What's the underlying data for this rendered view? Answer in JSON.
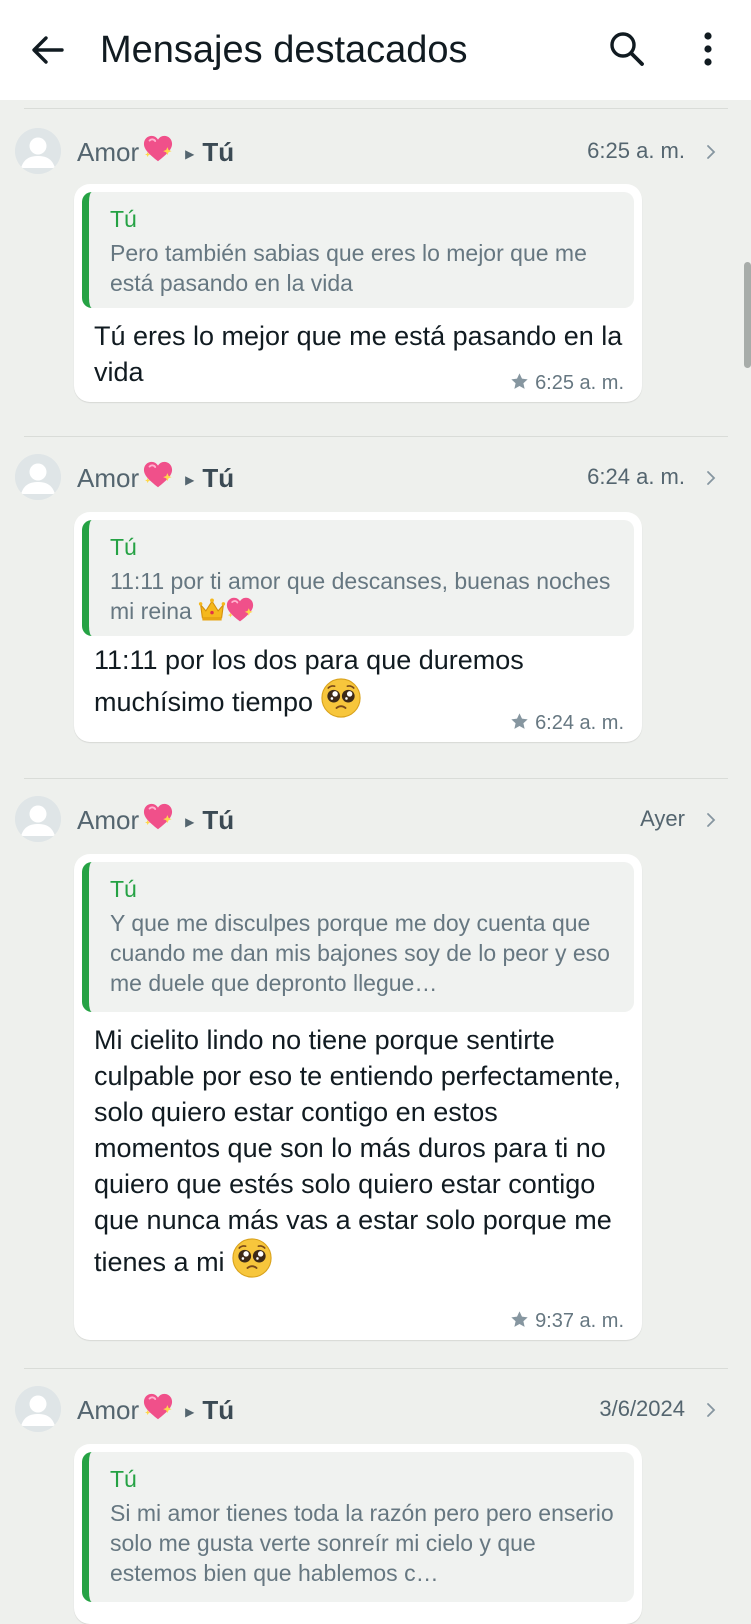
{
  "header": {
    "title": "Mensajes destacados",
    "icons": {
      "back": "arrow-left-icon",
      "search": "search-icon",
      "more": "more-vertical-icon"
    }
  },
  "colors": {
    "accent_green": "#25a244",
    "background": "#eef0ed",
    "bubble": "#ffffff",
    "quote_bg": "#f0f2f0",
    "secondary_text": "#667781"
  },
  "messages": [
    {
      "sender": "Amor",
      "sender_icon": "sparkling-heart-icon",
      "recipient": "Tú",
      "date": "6:25 a. m.",
      "quote_author": "Tú",
      "quote_text": "Pero también sabias que eres lo mejor que me está pasando en la vida",
      "text": "Tú eres lo mejor que me está pasando en la vida",
      "time": "6:25 a. m."
    },
    {
      "sender": "Amor",
      "sender_icon": "sparkling-heart-icon",
      "recipient": "Tú",
      "date": "6:24 a. m.",
      "quote_author": "Tú",
      "quote_text": "11:11 por ti amor que descanses, buenas noches mi reina",
      "quote_emojis": [
        "crown-icon",
        "sparkling-heart-icon"
      ],
      "text": "11:11 por los dos para que duremos muchísimo tiempo",
      "text_emoji": "pleading-face-icon",
      "time": "6:24 a. m."
    },
    {
      "sender": "Amor",
      "sender_icon": "sparkling-heart-icon",
      "recipient": "Tú",
      "date": "Ayer",
      "quote_author": "Tú",
      "quote_text": "Y que me disculpes porque me doy cuenta que cuando me dan mis bajones soy de lo peor y eso me duele que depronto llegue…",
      "text": "Mi cielito lindo no tiene porque sentirte culpable por eso te entiendo perfectamente, solo quiero estar contigo en estos momentos que son lo más duros para ti no quiero que estés solo quiero estar contigo que nunca más vas a estar solo porque me tienes a mi",
      "text_emoji": "pleading-face-icon",
      "time": "9:37 a. m."
    },
    {
      "sender": "Amor",
      "sender_icon": "sparkling-heart-icon",
      "recipient": "Tú",
      "date": "3/6/2024",
      "quote_author": "Tú",
      "quote_text": "Si mi amor tienes toda la razón pero pero enserio solo me gusta verte sonreír mi cielo y que estemos bien que hablemos c…"
    }
  ]
}
